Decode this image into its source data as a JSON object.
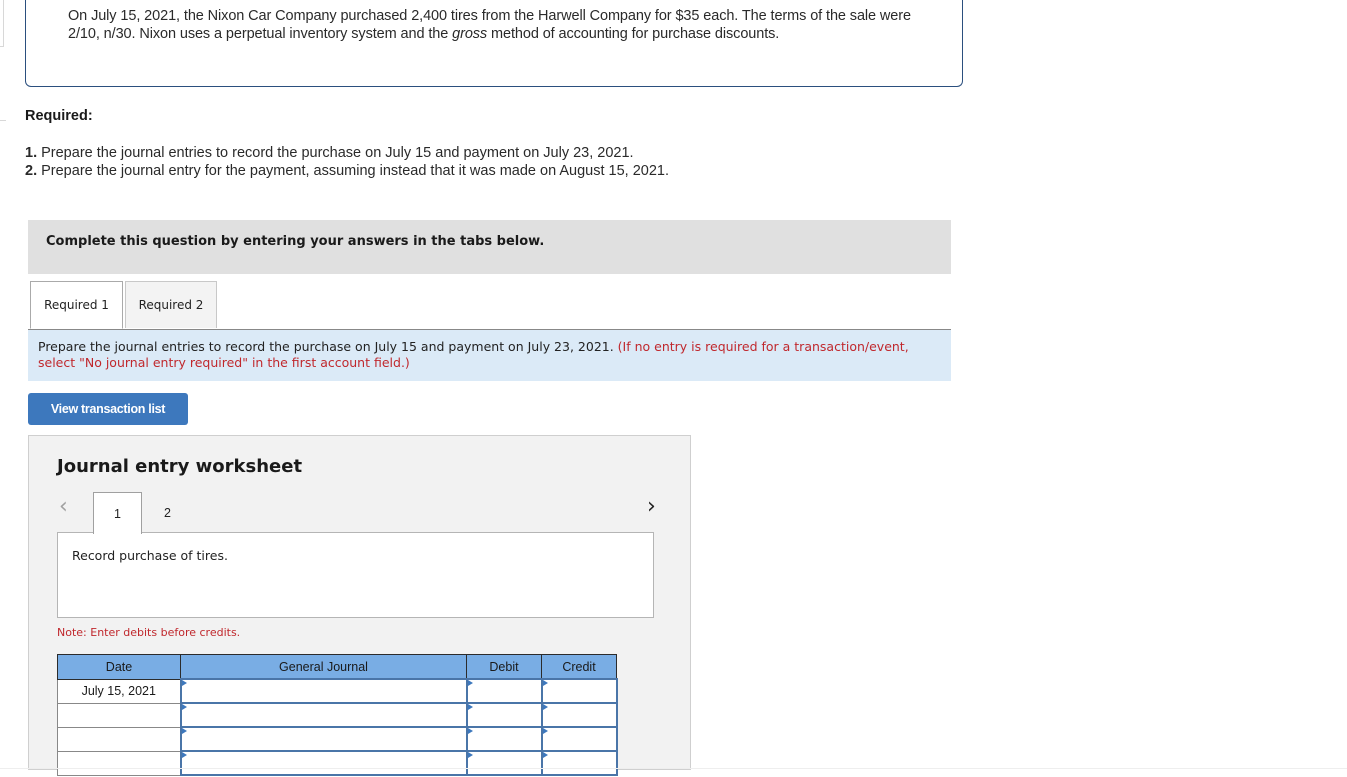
{
  "problem": {
    "text_before_italic": "On July 15, 2021, the Nixon Car Company purchased 2,400 tires from the Harwell Company for $35 each. The terms of the sale were 2/10, n/30. Nixon uses a perpetual inventory system and the ",
    "italic_word": "gross",
    "text_after_italic": " method of accounting for purchase discounts."
  },
  "required": {
    "title": "Required:",
    "items": [
      {
        "number": "1.",
        "text": " Prepare the journal entries to record the purchase on July 15 and payment on July 23, 2021."
      },
      {
        "number": "2.",
        "text": " Prepare the journal entry for the payment, assuming instead that it was made on August 15, 2021."
      }
    ]
  },
  "instruction": "Complete this question by entering your answers in the tabs below.",
  "tabs": [
    {
      "label": "Required 1",
      "active": true
    },
    {
      "label": "Required 2",
      "active": false
    }
  ],
  "prompt": {
    "text": "Prepare the journal entries to record the purchase on July 15 and payment on July 23, 2021. ",
    "note": "(If no entry is required for a transaction/event, select \"No journal entry required\" in the first account field.)"
  },
  "view_transaction_button": "View transaction list",
  "worksheet": {
    "title": "Journal entry worksheet",
    "prev_icon": "chevron-left-icon",
    "next_icon": "chevron-right-icon",
    "entry_tabs": [
      {
        "label": "1",
        "active": true
      },
      {
        "label": "2",
        "active": false
      }
    ],
    "description": "Record purchase of tires.",
    "note": "Note: Enter debits before credits.",
    "table": {
      "headers": [
        "Date",
        "General Journal",
        "Debit",
        "Credit"
      ],
      "rows": [
        {
          "date": "July 15, 2021",
          "account": "",
          "debit": "",
          "credit": ""
        },
        {
          "date": "",
          "account": "",
          "debit": "",
          "credit": ""
        },
        {
          "date": "",
          "account": "",
          "debit": "",
          "credit": ""
        },
        {
          "date": "",
          "account": "",
          "debit": "",
          "credit": ""
        }
      ]
    }
  },
  "colors": {
    "accent_button": "#3d78bd",
    "table_header": "#79ade4",
    "note_red": "#c0282d",
    "prompt_background": "#dbeaf7"
  }
}
